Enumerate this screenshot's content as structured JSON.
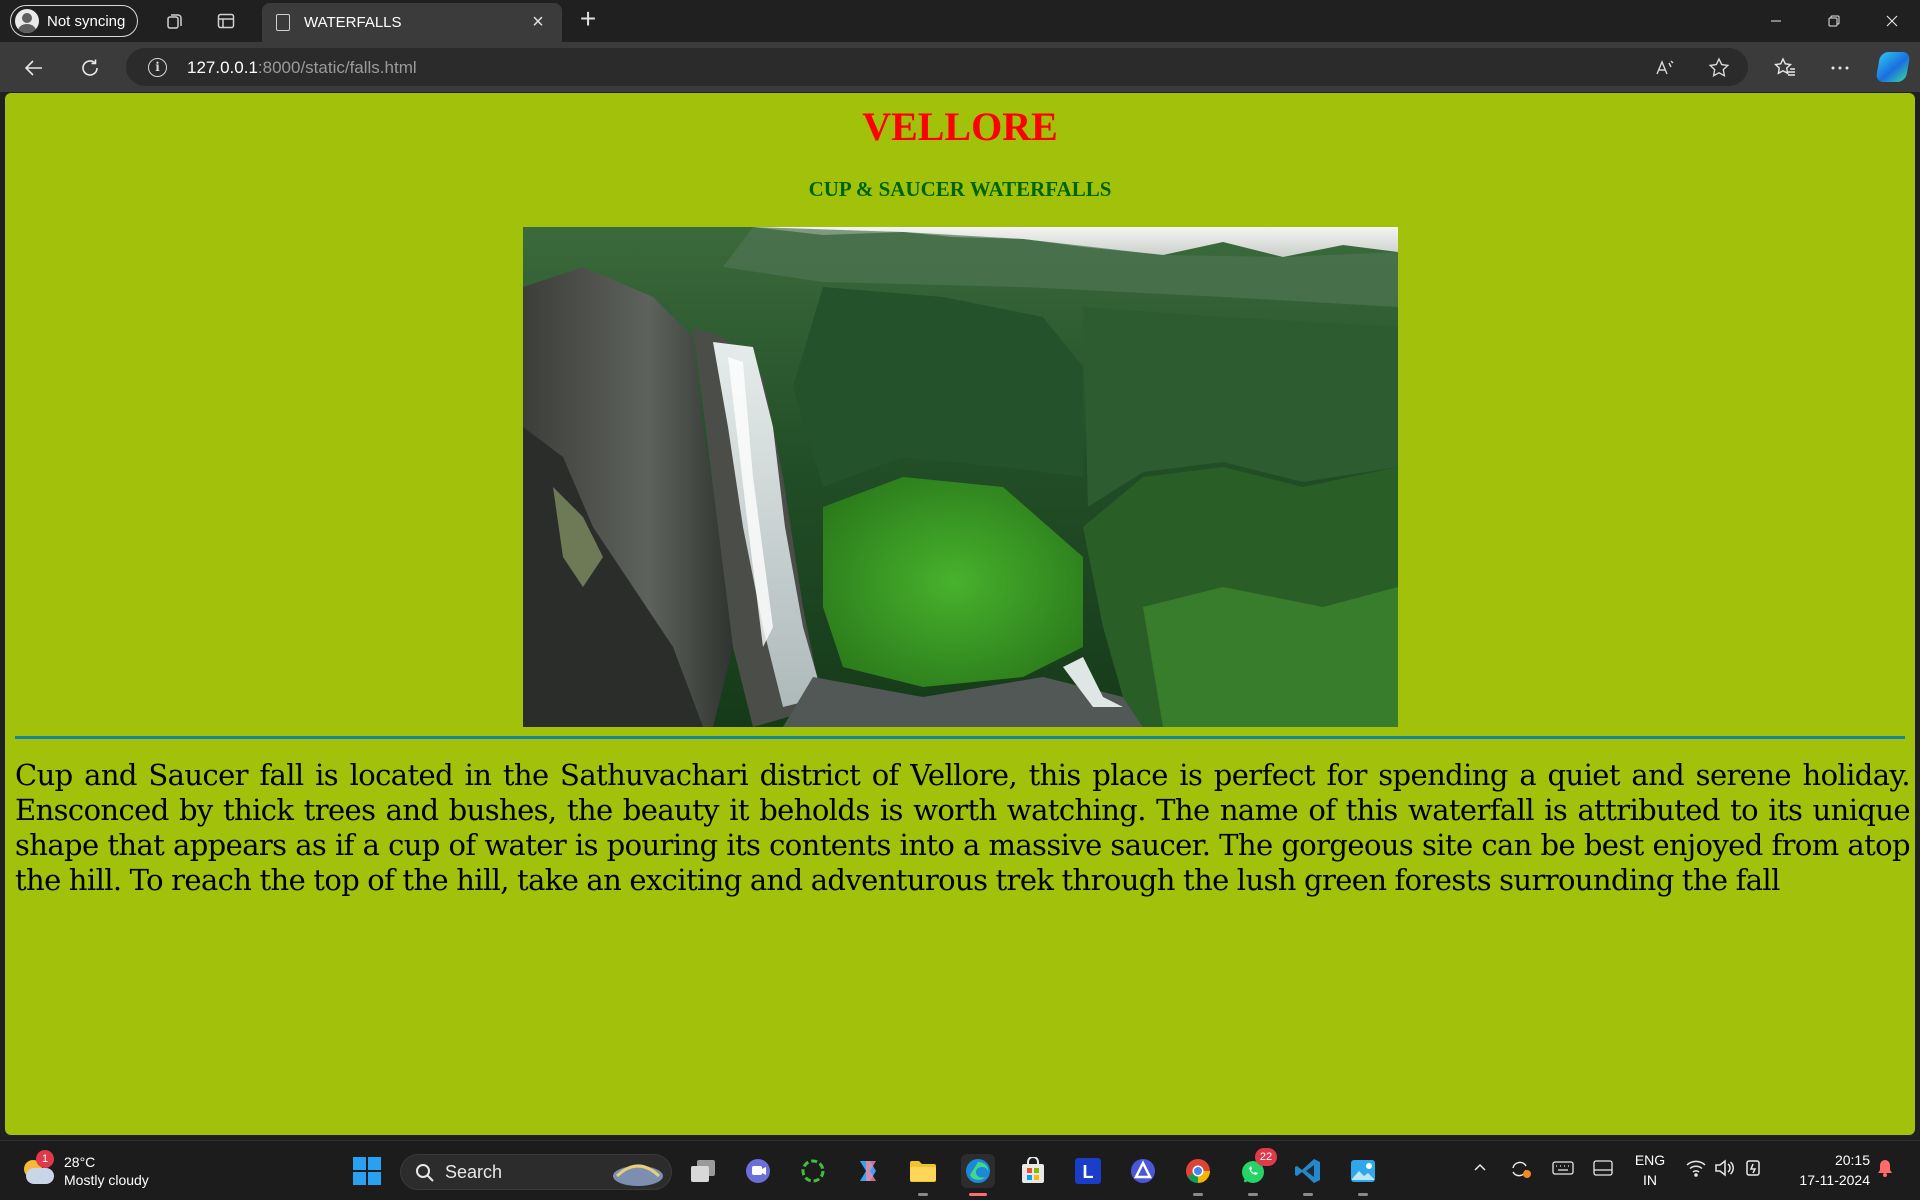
{
  "browser": {
    "profile_label": "Not syncing",
    "tab_title": "WATERFALLS",
    "url_host": "127.0.0.1",
    "url_path": ":8000/static/falls.html"
  },
  "page": {
    "heading": "VELLORE",
    "subheading": "CUP & SAUCER WATERFALLS",
    "image_subject": "waterfall in forest",
    "paragraph": "Cup and Saucer fall is located in the Sathuvachari district of Vellore, this place is perfect for spending a quiet and serene holiday. Ensconced by thick trees and bushes, the beauty it beholds is worth watching. The name of this waterfall is attributed to its unique shape that appears as if a cup of water is pouring its contents into a massive saucer. The gorgeous site can be best enjoyed from atop the hill. To reach the top of the hill, take an exciting and adventurous trek through the lush green forests surrounding the fall",
    "background_color": "#a2c10a",
    "heading_color": "#ff0000",
    "subheading_color": "#006400",
    "rule_color": "#16849a"
  },
  "taskbar": {
    "weather_temp": "28°C",
    "weather_text": "Mostly cloudy",
    "weather_badge": "1",
    "search_label": "Search",
    "whatsapp_badge": "22",
    "lang_top": "ENG",
    "lang_bottom": "IN",
    "time": "20:15",
    "date": "17-11-2024"
  }
}
